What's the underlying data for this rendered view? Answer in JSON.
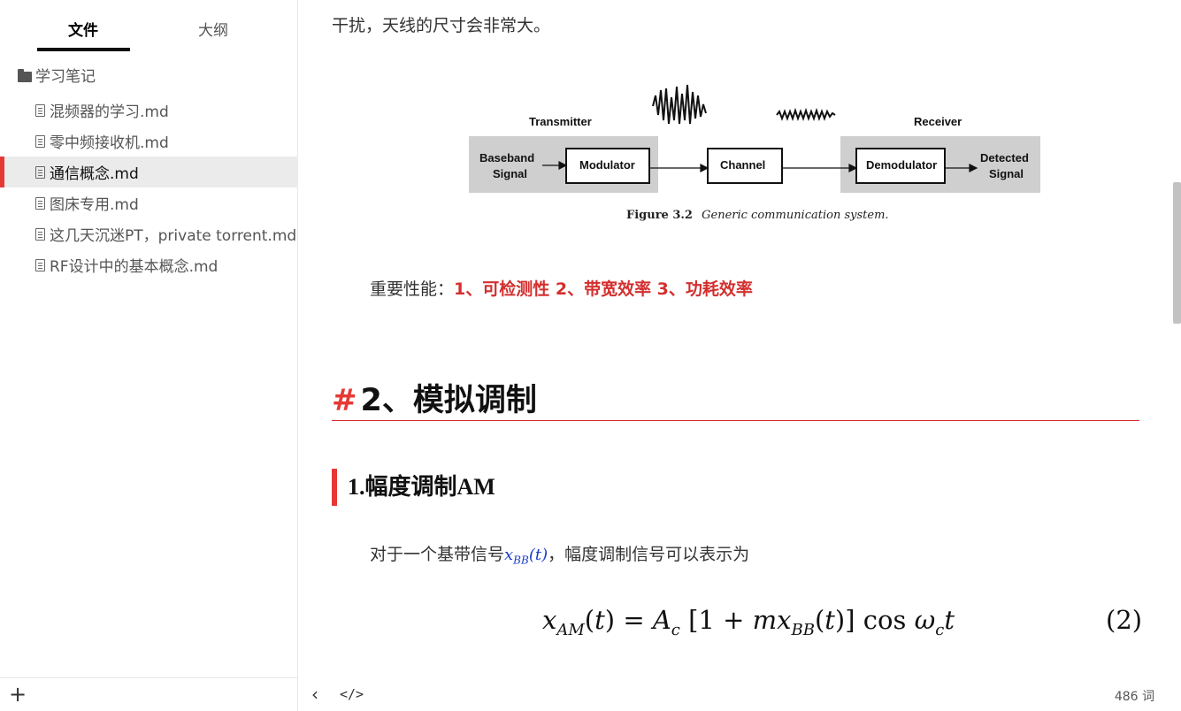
{
  "sidebar": {
    "tabs": [
      "文件",
      "大纲"
    ],
    "folder": "学习笔记",
    "files": [
      "混频器的学习.md",
      "零中频接收机.md",
      "通信概念.md",
      "图床专用.md",
      "这几天沉迷PT，private torrent.md",
      "RF设计中的基本概念.md"
    ],
    "add_label": "+"
  },
  "document": {
    "top_text": "干扰，天线的尺寸会非常大。",
    "figure": {
      "transmitter": "Transmitter",
      "receiver": "Receiver",
      "baseband": "Baseband",
      "signal": "Signal",
      "modulator": "Modulator",
      "channel": "Channel",
      "demodulator": "Demodulator",
      "detected": "Detected",
      "detected_signal": "Signal",
      "caption_label": "Figure 3.2",
      "caption_text": "Generic communication system."
    },
    "important_label": "重要性能：",
    "important_value": "1、可检测性 2、带宽效率 3、功耗效率",
    "h1_hash": "#",
    "h1_text": "2、模拟调制",
    "h2_text": "1.幅度调制AM",
    "para_before": "对于一个基带信号",
    "para_math": "x",
    "para_math_sub": "BB",
    "para_math_arg": "(t)",
    "para_after": "，幅度调制信号可以表示为",
    "equation_number": "(2)"
  },
  "footer": {
    "back": "‹",
    "source": "</>",
    "word_count": "486 词"
  }
}
